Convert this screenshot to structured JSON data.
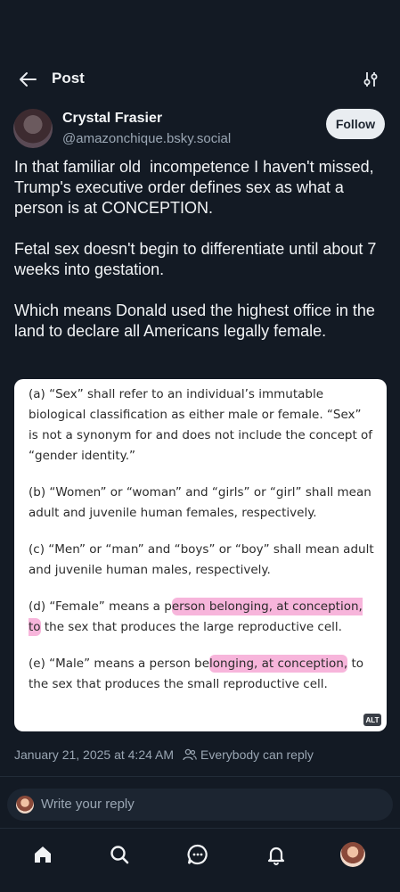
{
  "header": {
    "title": "Post"
  },
  "author": {
    "name": "Crystal Frasier",
    "handle": "@amazonchique.bsky.social",
    "follow_label": "Follow"
  },
  "post": {
    "paragraphs": [
      "In that familiar old  incompetence I haven't missed, Trump's executive order defines sex as what a person is at CONCEPTION.",
      "Fetal sex doesn't begin to differentiate until about 7 weeks into gestation.",
      "Which means Donald used the highest office in the land to declare all Americans legally female."
    ]
  },
  "image": {
    "clause_a": "(a) “Sex” shall refer to an individual’s immutable biological classification as either male or female. “Sex” is not a synonym for and does not include the concept of “gender identity.”",
    "clause_b": "(b) “Women” or “woman” and “girls” or “girl” shall mean adult and juvenile human females, respectively.",
    "clause_c": "(c) “Men” or “man” and “boys” or “boy” shall mean adult and juvenile human males, respectively.",
    "clause_d_pre": "(d) “Female” means a p",
    "clause_d_hl": "erson belonging, at conception, to",
    "clause_d_post": " the sex that produces the large reproductive cell.",
    "clause_e_pre": "(e) “Male” means a person be",
    "clause_e_hl": "longing, at conception,",
    "clause_e_post": " to the sex that produces the small reproductive cell.",
    "alt_label": "ALT",
    "highlight_color": "#f078be"
  },
  "meta": {
    "timestamp": "January 21, 2025 at 4:24 AM",
    "reply_setting": "Everybody can reply"
  },
  "reply": {
    "placeholder": "Write your reply"
  },
  "colors": {
    "background": "#131a24",
    "text": "#f1f3f5",
    "muted": "#9aa6b3"
  }
}
